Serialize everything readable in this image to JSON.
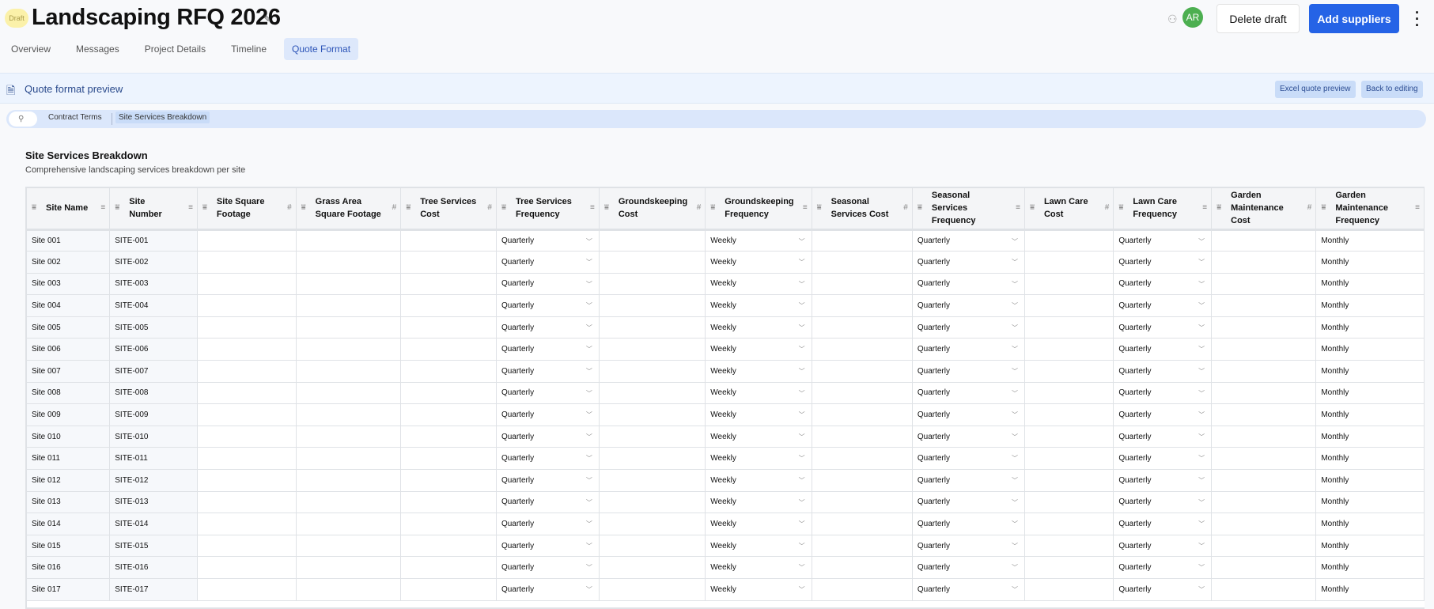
{
  "header": {
    "badge": "Draft",
    "title": "Landscaping RFQ 2026",
    "avatar": "AR",
    "delete_label": "Delete draft",
    "add_label": "Add suppliers"
  },
  "tabs": [
    "Overview",
    "Messages",
    "Project Details",
    "Timeline",
    "Quote Format"
  ],
  "active_tab": "Quote Format",
  "preview": {
    "label": "Quote format preview",
    "excel_label": "Excel quote preview",
    "back_label": "Back to editing"
  },
  "breadcrumbs": [
    "Contract Terms",
    "Site Services Breakdown"
  ],
  "section": {
    "title": "Site Services Breakdown",
    "subtitle": "Comprehensive landscaping services breakdown per site"
  },
  "columns": [
    {
      "label": "Site Name",
      "type": "text"
    },
    {
      "label": "Site Number",
      "type": "text"
    },
    {
      "label": "Site Square Footage",
      "type": "number"
    },
    {
      "label": "Grass Area Square Footage",
      "type": "number"
    },
    {
      "label": "Tree Services Cost",
      "type": "number"
    },
    {
      "label": "Tree Services Frequency",
      "type": "select"
    },
    {
      "label": "Groundskeeping Cost",
      "type": "number"
    },
    {
      "label": "Groundskeeping Frequency",
      "type": "select"
    },
    {
      "label": "Seasonal Services Cost",
      "type": "number"
    },
    {
      "label": "Seasonal Services Frequency",
      "type": "select"
    },
    {
      "label": "Lawn Care Cost",
      "type": "number"
    },
    {
      "label": "Lawn Care Frequency",
      "type": "select"
    },
    {
      "label": "Garden Maintenance Cost",
      "type": "number"
    },
    {
      "label": "Garden Maintenance Frequency",
      "type": "select"
    }
  ],
  "defaults": {
    "tree": "Quarterly",
    "grounds": "Weekly",
    "seasonal": "Quarterly",
    "lawn": "Quarterly",
    "garden": "Monthly"
  },
  "rows": [
    [
      "Site 001",
      "SITE-001"
    ],
    [
      "Site 002",
      "SITE-002"
    ],
    [
      "Site 003",
      "SITE-003"
    ],
    [
      "Site 004",
      "SITE-004"
    ],
    [
      "Site 005",
      "SITE-005"
    ],
    [
      "Site 006",
      "SITE-006"
    ],
    [
      "Site 007",
      "SITE-007"
    ],
    [
      "Site 008",
      "SITE-008"
    ],
    [
      "Site 009",
      "SITE-009"
    ],
    [
      "Site 010",
      "SITE-010"
    ],
    [
      "Site 011",
      "SITE-011"
    ],
    [
      "Site 012",
      "SITE-012"
    ],
    [
      "Site 013",
      "SITE-013"
    ],
    [
      "Site 014",
      "SITE-014"
    ],
    [
      "Site 015",
      "SITE-015"
    ],
    [
      "Site 016",
      "SITE-016"
    ],
    [
      "Site 017",
      "SITE-017"
    ]
  ],
  "colors": {
    "accent": "#2563e6",
    "avatar": "#4caf50",
    "draft_badge": "#fbf1a9"
  }
}
